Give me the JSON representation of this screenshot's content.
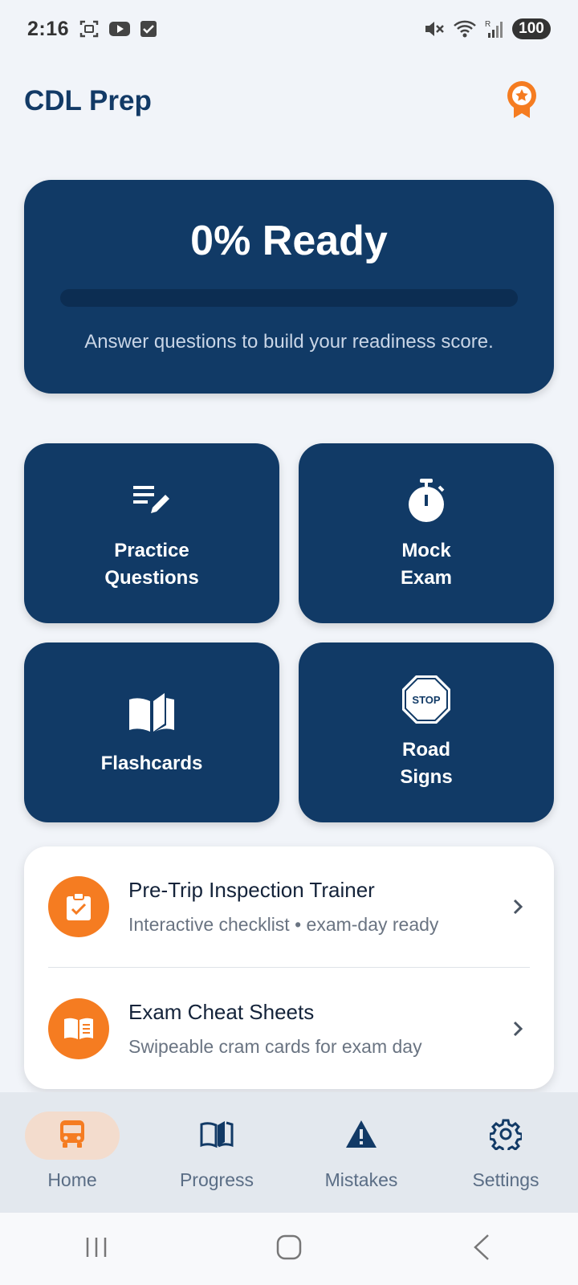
{
  "status": {
    "time": "2:16",
    "battery": "100",
    "signal_label": "R"
  },
  "app": {
    "title": "CDL Prep"
  },
  "readiness": {
    "title": "0% Ready",
    "progress_fraction": 0,
    "subtitle": "Answer questions to build your readiness score."
  },
  "tiles": [
    {
      "line1": "Practice",
      "line2": "Questions",
      "icon": "edit-list-icon"
    },
    {
      "line1": "Mock",
      "line2": "Exam",
      "icon": "stopwatch-icon"
    },
    {
      "line1": "Flashcards",
      "line2": "",
      "icon": "open-book-icon"
    },
    {
      "line1": "Road",
      "line2": "Signs",
      "icon": "stop-sign-icon",
      "icon_text": "STOP"
    }
  ],
  "list": [
    {
      "title": "Pre-Trip Inspection Trainer",
      "subtitle": "Interactive checklist • exam-day ready",
      "icon": "clipboard-check-icon"
    },
    {
      "title": "Exam Cheat Sheets",
      "subtitle": "Swipeable cram cards for exam day",
      "icon": "book-icon"
    }
  ],
  "nav": [
    {
      "label": "Home",
      "icon": "bus-icon",
      "active": true
    },
    {
      "label": "Progress",
      "icon": "map-book-icon",
      "active": false
    },
    {
      "label": "Mistakes",
      "icon": "warning-icon",
      "active": false
    },
    {
      "label": "Settings",
      "icon": "gear-icon",
      "active": false
    }
  ],
  "colors": {
    "primary": "#113a66",
    "accent": "#f57c21",
    "background": "#f1f4f9"
  }
}
